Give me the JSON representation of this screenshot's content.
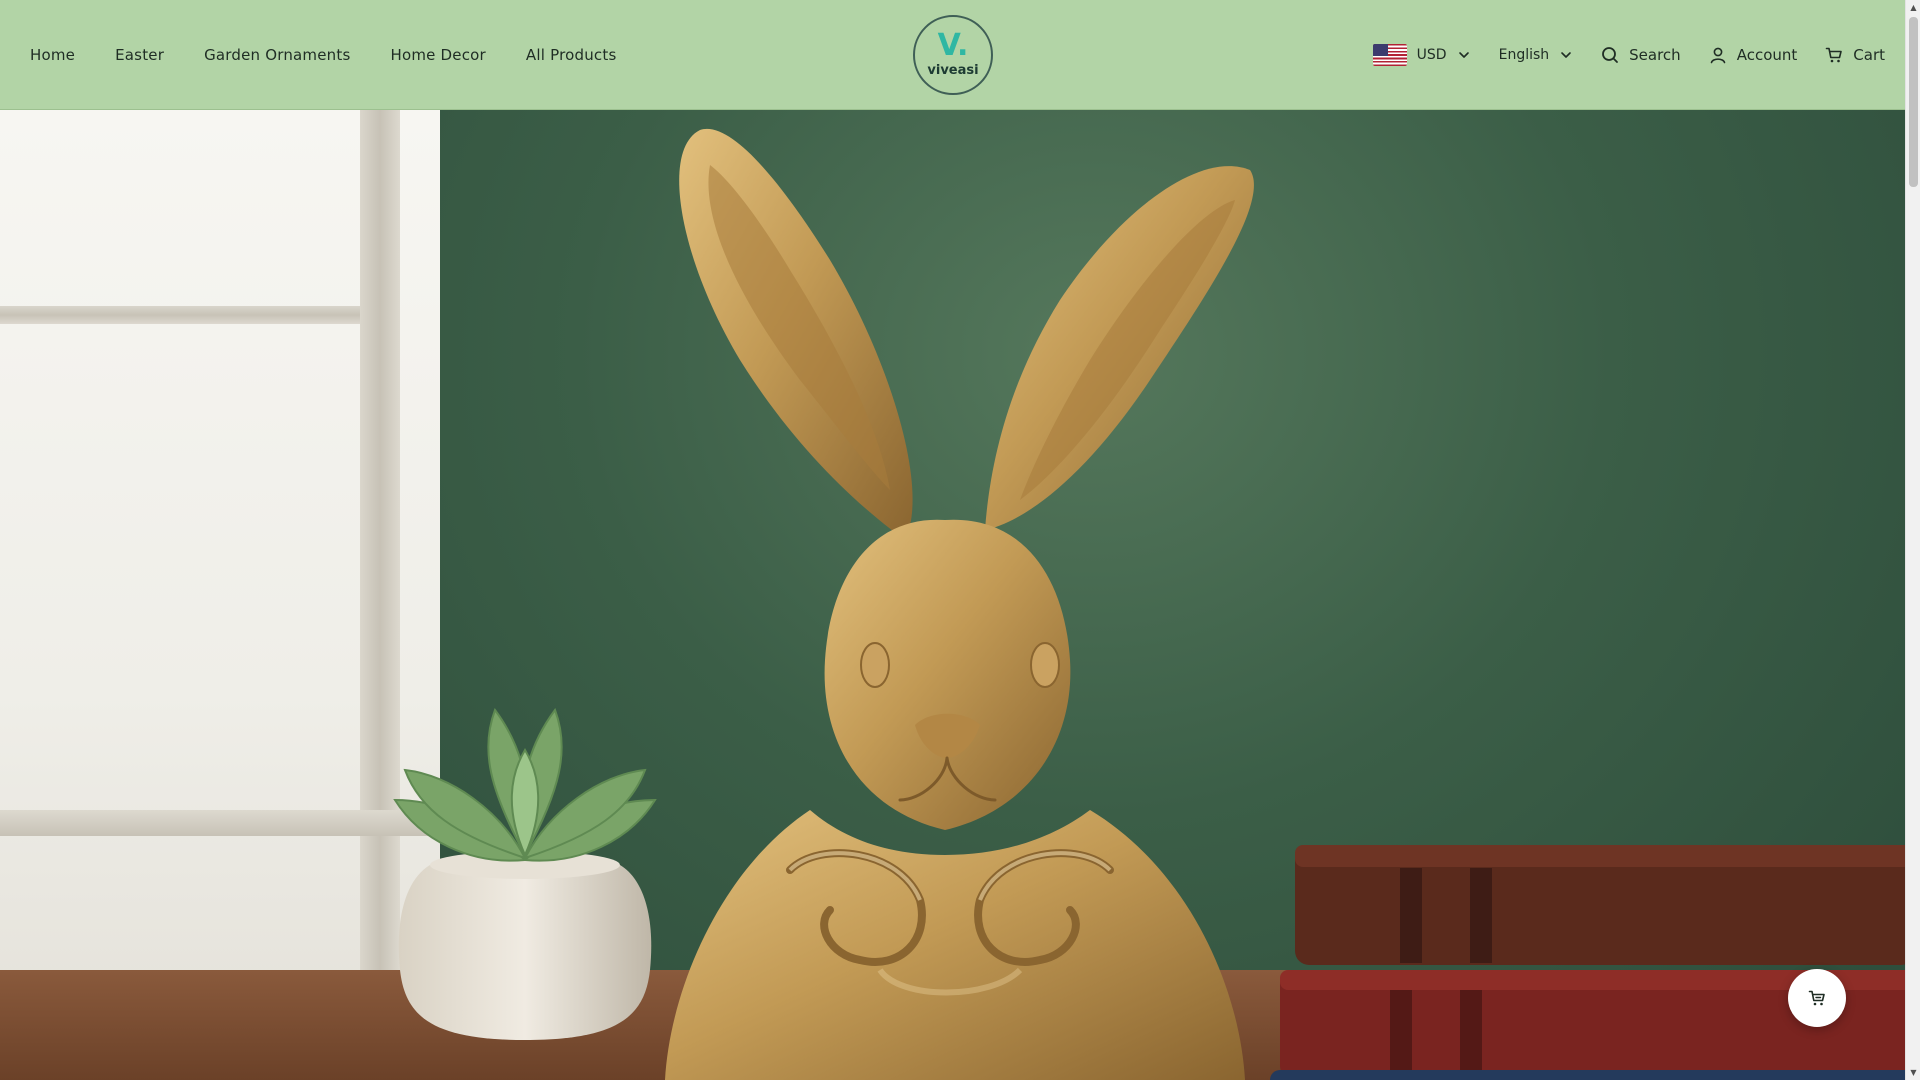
{
  "header": {
    "nav": [
      {
        "label": "Home"
      },
      {
        "label": "Easter"
      },
      {
        "label": "Garden Ornaments"
      },
      {
        "label": "Home Decor"
      },
      {
        "label": "All Products"
      }
    ],
    "logo": {
      "mark": "V.",
      "text": "viveasi"
    },
    "currency": {
      "value": "USD",
      "flag_icon": "us-flag-icon"
    },
    "language": {
      "value": "English"
    },
    "search_label": "Search",
    "account_label": "Account",
    "cart_label": "Cart"
  },
  "colors": {
    "header_bg": "#b2d4a6",
    "logo_accent": "#2fb7a3",
    "text_dark": "#1f2d24"
  },
  "icons": {
    "search": "search-icon",
    "account": "user-icon",
    "cart": "cart-icon",
    "chevron": "chevron-down-icon",
    "float_cart": "cart-icon"
  }
}
